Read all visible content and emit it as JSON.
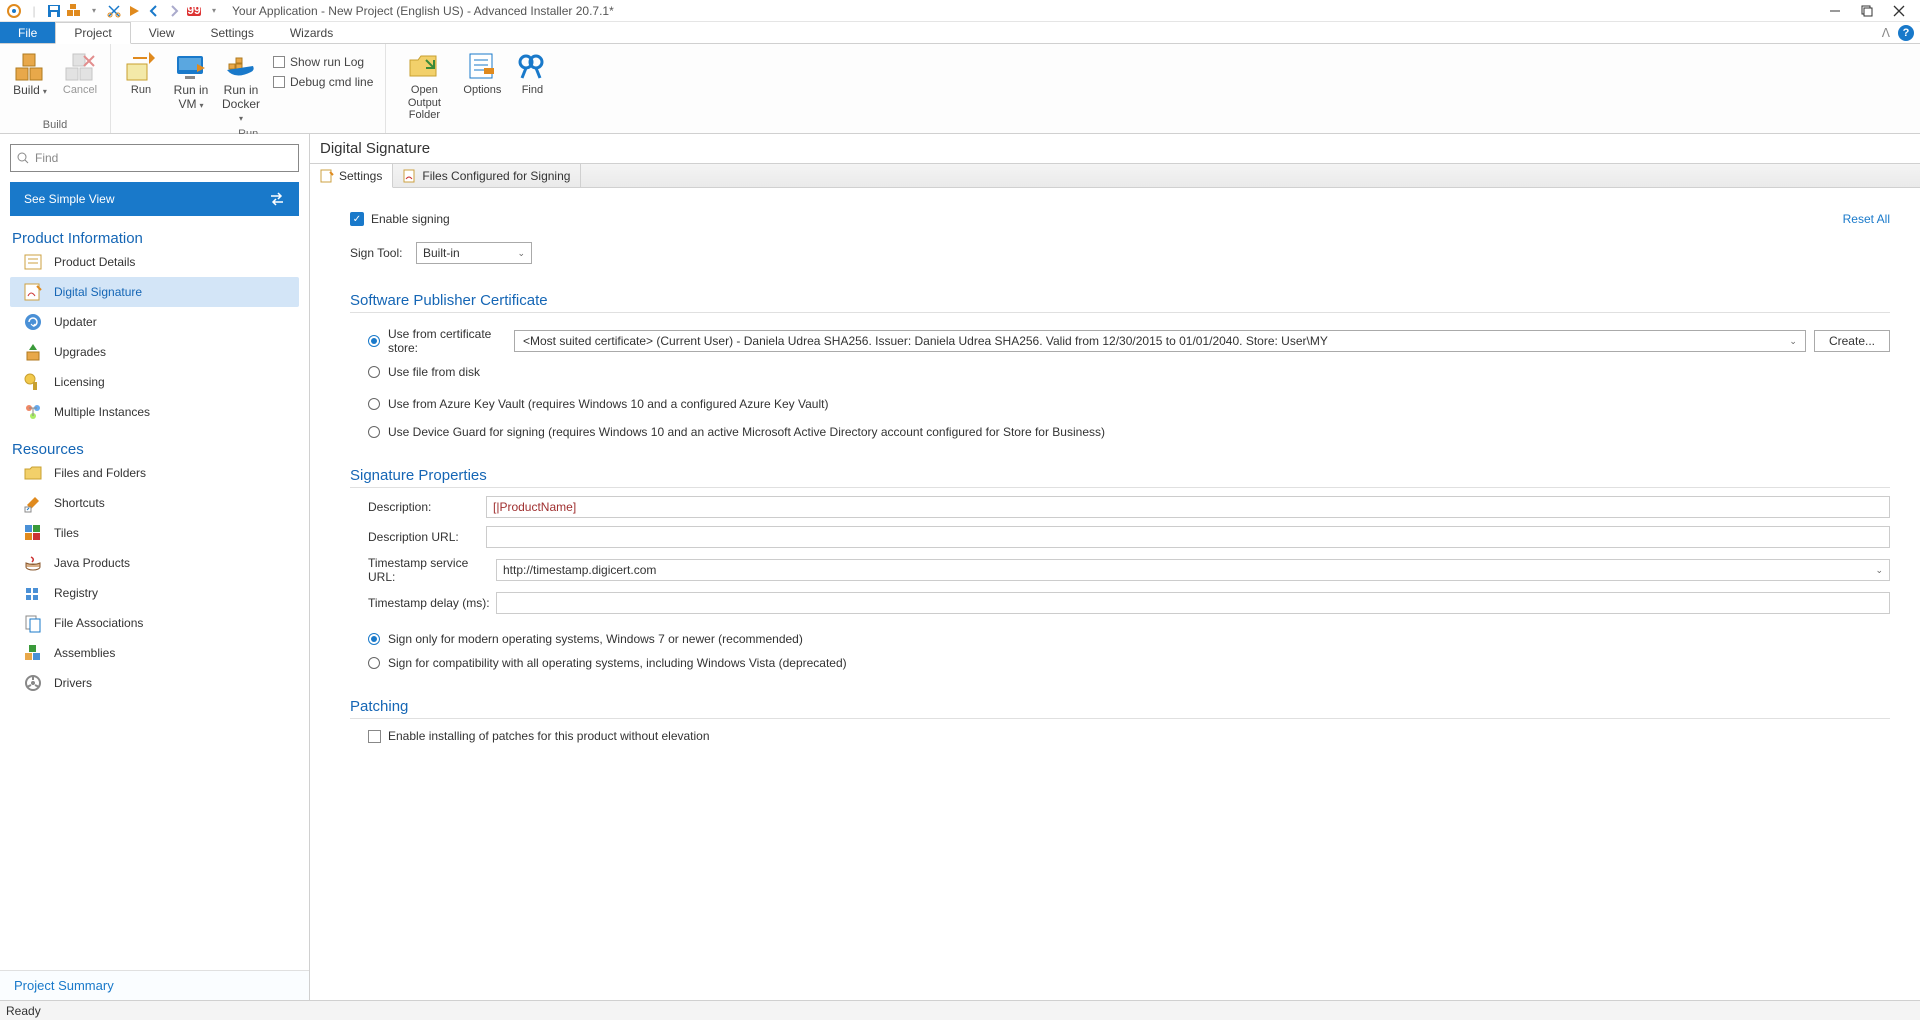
{
  "title": "Your Application - New Project (English US) - Advanced Installer 20.7.1*",
  "ribbonTabs": {
    "file": "File",
    "project": "Project",
    "view": "View",
    "settings": "Settings",
    "wizards": "Wizards"
  },
  "ribbon": {
    "build": "Build",
    "cancel": "Cancel",
    "run": "Run",
    "runvm": "Run in\nVM",
    "rundocker": "Run in\nDocker",
    "showrunlog": "Show run Log",
    "debugcmd": "Debug cmd line",
    "openoutput": "Open Output\nFolder",
    "options": "Options",
    "find": "Find",
    "grp_build": "Build",
    "grp_run": "Run"
  },
  "sidebar": {
    "find_placeholder": "Find",
    "simple_view": "See Simple View",
    "grp_product": "Product Information",
    "items_product": [
      "Product Details",
      "Digital Signature",
      "Updater",
      "Upgrades",
      "Licensing",
      "Multiple Instances"
    ],
    "grp_resources": "Resources",
    "items_resources": [
      "Files and Folders",
      "Shortcuts",
      "Tiles",
      "Java Products",
      "Registry",
      "File Associations",
      "Assemblies",
      "Drivers"
    ],
    "footer": "Project Summary"
  },
  "main": {
    "title": "Digital Signature",
    "tab_settings": "Settings",
    "tab_files": "Files Configured for Signing",
    "enable_signing": "Enable signing",
    "reset_all": "Reset All",
    "sign_tool_label": "Sign Tool:",
    "sign_tool_value": "Built-in",
    "sec_cert": "Software Publisher Certificate",
    "cert_store": "Use from certificate store:",
    "cert_store_value": "<Most suited certificate> (Current User)  -  Daniela Udrea SHA256. Issuer: Daniela Udrea SHA256. Valid from 12/30/2015 to 01/01/2040. Store: User\\MY",
    "create_btn": "Create...",
    "cert_file": "Use file from disk",
    "cert_azure": "Use from Azure Key Vault (requires Windows 10 and a configured Azure Key Vault)",
    "cert_device": "Use Device Guard for signing (requires Windows 10 and an active Microsoft Active Directory account configured for Store for Business)",
    "sec_sigprops": "Signature Properties",
    "desc_label": "Description:",
    "desc_value": "[|ProductName]",
    "descurl_label": "Description URL:",
    "ts_label": "Timestamp service URL:",
    "ts_value": "http://timestamp.digicert.com",
    "tsdelay_label": "Timestamp delay (ms):",
    "sign_modern": "Sign only for modern operating systems, Windows 7 or newer (recommended)",
    "sign_compat": "Sign for compatibility with all operating systems, including Windows Vista (deprecated)",
    "sec_patching": "Patching",
    "patch_chk": "Enable installing of patches for this product without elevation"
  },
  "status": "Ready"
}
